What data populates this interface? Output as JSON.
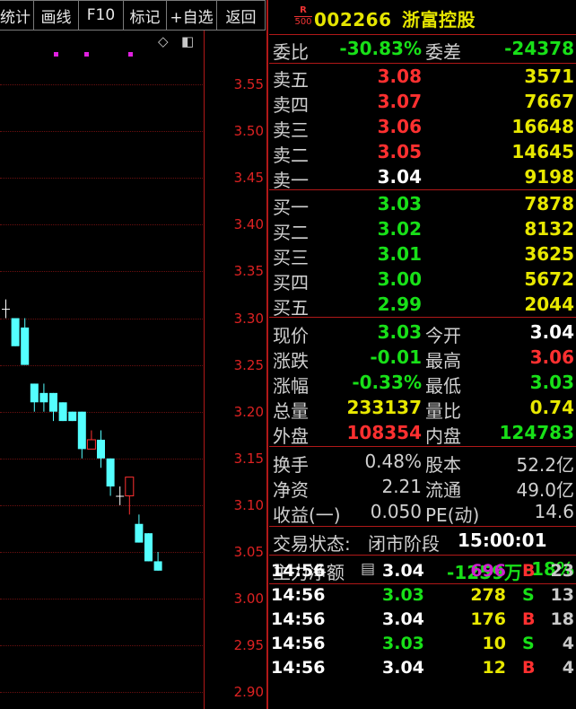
{
  "toolbar": [
    "统计",
    "画线",
    "F10",
    "标记",
    "+自选",
    "返回"
  ],
  "chart_data": {
    "type": "candlestick",
    "y_ticks": [
      "3.55",
      "3.50",
      "3.45",
      "3.40",
      "3.35",
      "3.30",
      "3.25",
      "3.20",
      "3.15",
      "3.10",
      "3.05",
      "3.00",
      "2.95",
      "2.90"
    ],
    "candles": [
      {
        "o": 3.31,
        "c": 3.31,
        "h": 3.32,
        "l": 3.3,
        "color": "white"
      },
      {
        "o": 3.3,
        "c": 3.27,
        "h": 3.3,
        "l": 3.27,
        "color": "cyan"
      },
      {
        "o": 3.29,
        "c": 3.25,
        "h": 3.3,
        "l": 3.25,
        "color": "cyan"
      },
      {
        "o": 3.23,
        "c": 3.21,
        "h": 3.23,
        "l": 3.2,
        "color": "cyan"
      },
      {
        "o": 3.22,
        "c": 3.21,
        "h": 3.23,
        "l": 3.2,
        "color": "cyan"
      },
      {
        "o": 3.22,
        "c": 3.2,
        "h": 3.22,
        "l": 3.19,
        "color": "cyan"
      },
      {
        "o": 3.21,
        "c": 3.19,
        "h": 3.21,
        "l": 3.19,
        "color": "cyan"
      },
      {
        "o": 3.2,
        "c": 3.19,
        "h": 3.2,
        "l": 3.19,
        "color": "cyan"
      },
      {
        "o": 3.2,
        "c": 3.16,
        "h": 3.2,
        "l": 3.15,
        "color": "cyan"
      },
      {
        "o": 3.16,
        "c": 3.17,
        "h": 3.18,
        "l": 3.16,
        "color": "red"
      },
      {
        "o": 3.17,
        "c": 3.15,
        "h": 3.18,
        "l": 3.14,
        "color": "cyan"
      },
      {
        "o": 3.15,
        "c": 3.12,
        "h": 3.15,
        "l": 3.11,
        "color": "cyan"
      },
      {
        "o": 3.11,
        "c": 3.11,
        "h": 3.12,
        "l": 3.1,
        "color": "white"
      },
      {
        "o": 3.11,
        "c": 3.13,
        "h": 3.13,
        "l": 3.09,
        "color": "red"
      },
      {
        "o": 3.08,
        "c": 3.06,
        "h": 3.09,
        "l": 3.06,
        "color": "cyan"
      },
      {
        "o": 3.07,
        "c": 3.04,
        "h": 3.07,
        "l": 3.04,
        "color": "cyan"
      },
      {
        "o": 3.04,
        "c": 3.03,
        "h": 3.05,
        "l": 3.03,
        "color": "cyan"
      }
    ]
  },
  "header": {
    "badge_top": "R",
    "badge_bottom": "500",
    "code": "002266",
    "name": "浙富控股"
  },
  "ratio": {
    "l1": "委比",
    "v1": "-30.83%",
    "l2": "委差",
    "v2": "-24378"
  },
  "asks": [
    {
      "label": "卖五",
      "price": "3.08",
      "vol": "3571"
    },
    {
      "label": "卖四",
      "price": "3.07",
      "vol": "7667"
    },
    {
      "label": "卖三",
      "price": "3.06",
      "vol": "16648"
    },
    {
      "label": "卖二",
      "price": "3.05",
      "vol": "14645"
    },
    {
      "label": "卖一",
      "price": "3.04",
      "vol": "9198"
    }
  ],
  "bids": [
    {
      "label": "买一",
      "price": "3.03",
      "vol": "7878"
    },
    {
      "label": "买二",
      "price": "3.02",
      "vol": "8132"
    },
    {
      "label": "买三",
      "price": "3.01",
      "vol": "3625"
    },
    {
      "label": "买四",
      "price": "3.00",
      "vol": "5672"
    },
    {
      "label": "买五",
      "price": "2.99",
      "vol": "2044"
    }
  ],
  "quote": [
    {
      "l1": "现价",
      "v1": "3.03",
      "c1": "green",
      "l2": "今开",
      "v2": "3.04",
      "c2": "white"
    },
    {
      "l1": "涨跌",
      "v1": "-0.01",
      "c1": "green",
      "l2": "最高",
      "v2": "3.06",
      "c2": "red"
    },
    {
      "l1": "涨幅",
      "v1": "-0.33%",
      "c1": "green",
      "l2": "最低",
      "v2": "3.03",
      "c2": "green"
    },
    {
      "l1": "总量",
      "v1": "233137",
      "c1": "yellow",
      "l2": "量比",
      "v2": "0.74",
      "c2": "yellow"
    },
    {
      "l1": "外盘",
      "v1": "108354",
      "c1": "red",
      "l2": "内盘",
      "v2": "124783",
      "c2": "green"
    }
  ],
  "fundamentals": [
    {
      "l1": "换手",
      "v1": "0.48%",
      "l2": "股本",
      "v2": "52.2亿"
    },
    {
      "l1": "净资",
      "v1": "2.21",
      "l2": "流通",
      "v2": "49.0亿"
    },
    {
      "l1": "收益(一)",
      "v1": "0.050",
      "l2": "PE(动)",
      "v2": "14.6"
    }
  ],
  "status": {
    "label": "交易状态:",
    "value": "闭市阶段",
    "time": "15:00:01"
  },
  "main_flow": {
    "label": "主力净额",
    "value": "-1259万",
    "pct": "-18%"
  },
  "ticks": [
    {
      "time": "14:56",
      "price": "3.04",
      "pc": "white",
      "vol": "696",
      "vc": "purple",
      "bs": "B",
      "bc": "red",
      "num": "23"
    },
    {
      "time": "14:56",
      "price": "3.03",
      "pc": "green",
      "vol": "278",
      "vc": "yellow",
      "bs": "S",
      "bc": "green",
      "num": "13"
    },
    {
      "time": "14:56",
      "price": "3.04",
      "pc": "white",
      "vol": "176",
      "vc": "yellow",
      "bs": "B",
      "bc": "red",
      "num": "18"
    },
    {
      "time": "14:56",
      "price": "3.03",
      "pc": "green",
      "vol": "10",
      "vc": "yellow",
      "bs": "S",
      "bc": "green",
      "num": "4"
    },
    {
      "time": "14:56",
      "price": "3.04",
      "pc": "white",
      "vol": "12",
      "vc": "yellow",
      "bs": "B",
      "bc": "red",
      "num": "4"
    }
  ]
}
